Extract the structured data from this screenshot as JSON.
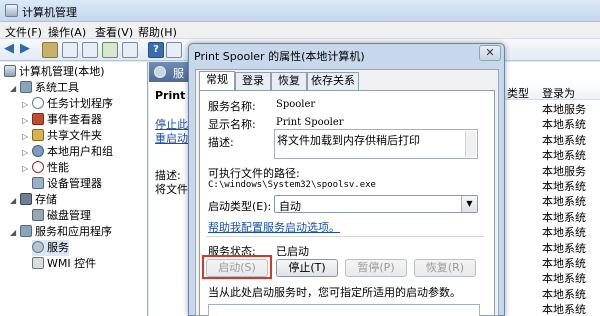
{
  "window": {
    "title": "计算机管理"
  },
  "menu": [
    "文件(F)",
    "操作(A)",
    "查看(V)",
    "帮助(H)"
  ],
  "tree": {
    "root": "计算机管理(本地)",
    "items": [
      {
        "label": "系统工具"
      },
      {
        "label": "任务计划程序"
      },
      {
        "label": "事件查看器"
      },
      {
        "label": "共享文件夹"
      },
      {
        "label": "本地用户和组"
      },
      {
        "label": "性能"
      },
      {
        "label": "设备管理器"
      },
      {
        "label": "存储"
      },
      {
        "label": "磁盘管理"
      },
      {
        "label": "服务和应用程序"
      },
      {
        "label": "服务"
      },
      {
        "label": "WMI 控件"
      }
    ]
  },
  "middle": {
    "header": "服",
    "title": "Print S",
    "link1": "停止此",
    "link2": "重启动",
    "desc_label": "描述:",
    "desc_text": "将文件加"
  },
  "list": {
    "columns": [
      "类型",
      "登录为"
    ],
    "rows": [
      "本地服务",
      "本地系统",
      "本地系统",
      "本地系统",
      "本地服务",
      "本地系统",
      "本地系统",
      "本地系统",
      "本地系统",
      "本地系统",
      "本地系统",
      "本地系统",
      "本地系统",
      "本地系统"
    ]
  },
  "dialog": {
    "title": "Print Spooler 的属性(本地计算机)",
    "close": "✕",
    "tabs": [
      "常规",
      "登录",
      "恢复",
      "依存关系"
    ],
    "service_name_label": "服务名称:",
    "service_name": "Spooler",
    "display_name_label": "显示名称:",
    "display_name": "Print Spooler",
    "description_label": "描述:",
    "description": "将文件加载到内存供稍后打印",
    "exec_path_label": "可执行文件的路径:",
    "exec_path": "C:\\windows\\System32\\spoolsv.exe",
    "startup_type_label": "启动类型(E):",
    "startup_type": "自动",
    "help_link": "帮助我配置服务启动选项。",
    "status_label": "服务状态:",
    "status_value": "已启动",
    "buttons": {
      "start": "启动(S)",
      "stop": "停止(T)",
      "pause": "暂停(P)",
      "resume": "恢复(R)"
    },
    "hint": "当从此处启动服务时，您可指定所适用的启动参数。"
  }
}
